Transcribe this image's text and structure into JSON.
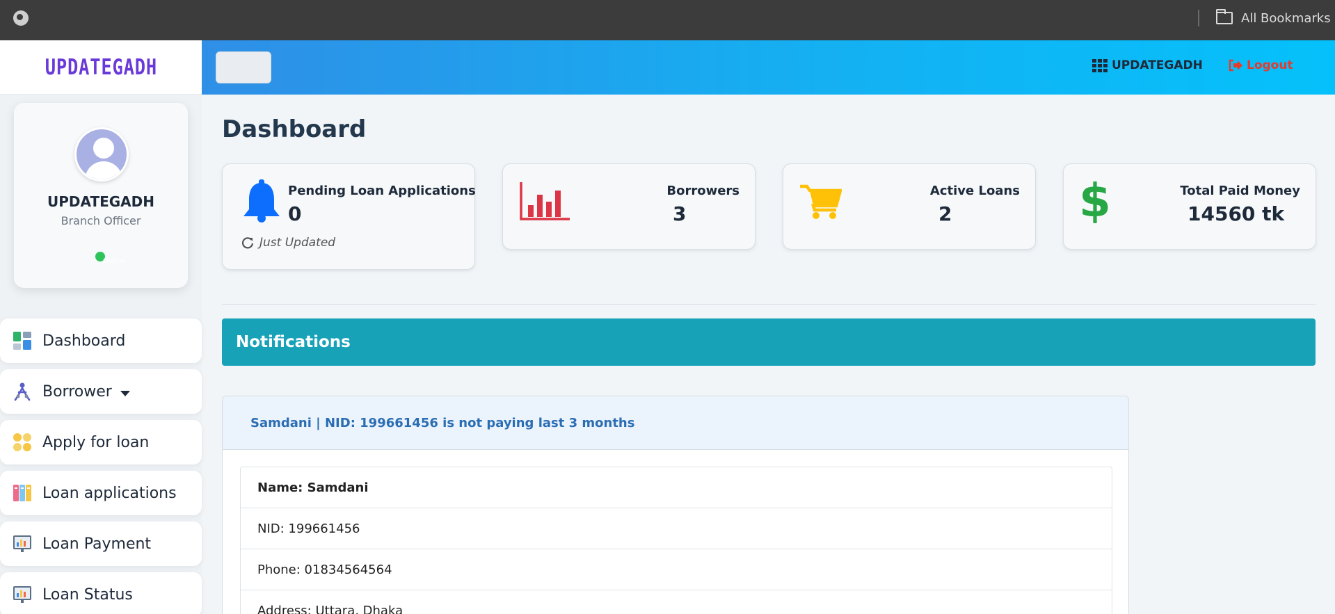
{
  "browser": {
    "bookmarks_label": "All Bookmarks",
    "globe_icon": "globe-icon",
    "folder_icon": "folder-icon"
  },
  "brand": {
    "logo_text": "UPDATEGADH"
  },
  "profile": {
    "name": "UPDATEGADH",
    "role": "Branch Officer",
    "status": "Online"
  },
  "sidebar": {
    "items": [
      {
        "label": "Dashboard",
        "icon": "dashboard-icon"
      },
      {
        "label": "Borrower",
        "icon": "borrower-icon",
        "has_dropdown": true
      },
      {
        "label": "Apply for loan",
        "icon": "apply-loan-icon"
      },
      {
        "label": "Loan applications",
        "icon": "loan-applications-icon"
      },
      {
        "label": "Loan Payment",
        "icon": "loan-payment-icon"
      },
      {
        "label": "Loan Status",
        "icon": "loan-status-icon"
      }
    ]
  },
  "topnav": {
    "brand_label": "UPDATEGADH",
    "logout_label": "Logout"
  },
  "page": {
    "title": "Dashboard"
  },
  "cards": [
    {
      "label": "Pending Loan Applications",
      "value": "0",
      "footer": "Just Updated",
      "icon": "bell-icon",
      "color": "#0d6efd"
    },
    {
      "label": "Borrowers",
      "value": "3",
      "icon": "bar-chart-icon",
      "color": "#dc3545"
    },
    {
      "label": "Active Loans",
      "value": "2",
      "icon": "cart-icon",
      "color": "#ffc107"
    },
    {
      "label": "Total Paid Money",
      "value": "14560 tk",
      "icon": "dollar-icon",
      "color": "#28a745"
    }
  ],
  "notifications": {
    "title": "Notifications",
    "item": {
      "headline": "Samdani | NID: 199661456 is not paying last 3 months",
      "name": "Name: Samdani",
      "nid": "NID: 199661456",
      "phone": "Phone: 01834564564",
      "address": "Address: Uttara, Dhaka"
    }
  },
  "colors": {
    "nav_gradient_start": "#2f8fe6",
    "nav_gradient_end": "#05c1fb",
    "notif_bar": "#17a2b8",
    "logout": "#e43b2c",
    "logo": "#6a3ad8"
  }
}
